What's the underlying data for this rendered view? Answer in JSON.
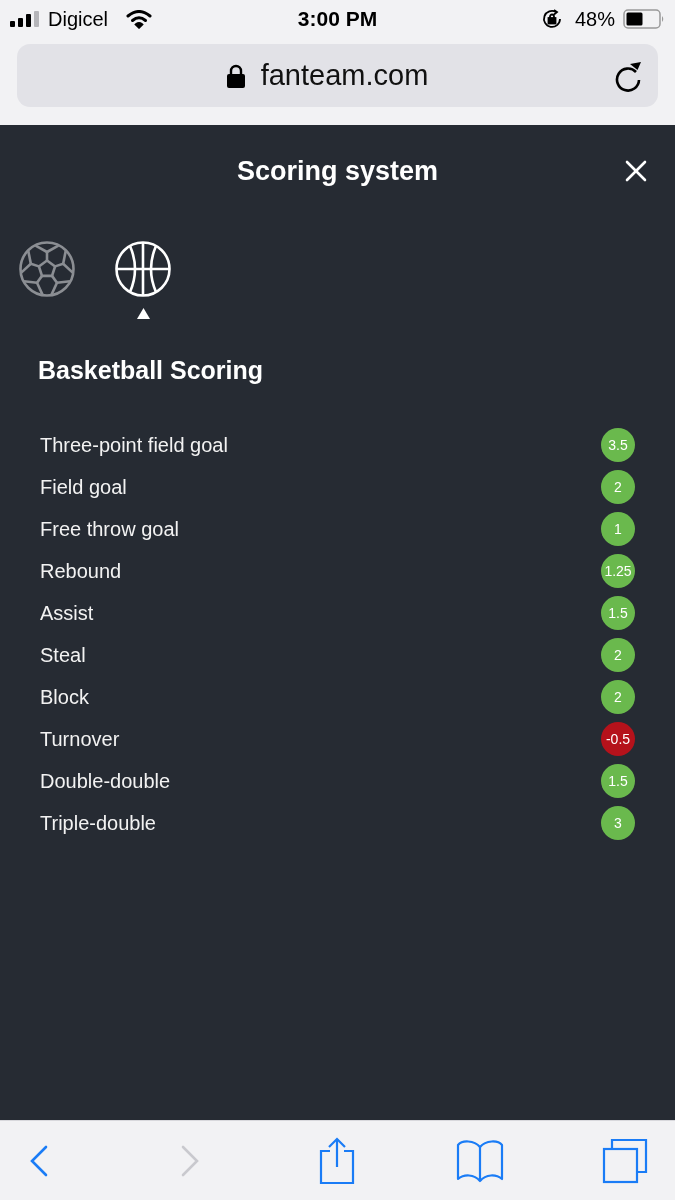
{
  "status_bar": {
    "carrier": "Digicel",
    "time": "3:00 PM",
    "battery": "48%"
  },
  "address_bar": {
    "url": "fanteam.com"
  },
  "modal": {
    "title": "Scoring system",
    "sports": [
      {
        "kind": "soccer",
        "selected": false
      },
      {
        "kind": "basketball",
        "selected": true
      }
    ],
    "heading": "Basketball Scoring",
    "rules": [
      {
        "label": "Three-point field goal",
        "points": "3.5",
        "color": "#6ab94d"
      },
      {
        "label": "Field goal",
        "points": "2",
        "color": "#6ab94d"
      },
      {
        "label": "Free throw goal",
        "points": "1",
        "color": "#6ab94d"
      },
      {
        "label": "Rebound",
        "points": "1.25",
        "color": "#6ab94d"
      },
      {
        "label": "Assist",
        "points": "1.5",
        "color": "#6ab94d"
      },
      {
        "label": "Steal",
        "points": "2",
        "color": "#6ab94d"
      },
      {
        "label": "Block",
        "points": "2",
        "color": "#6ab94d"
      },
      {
        "label": "Turnover",
        "points": "-0.5",
        "color": "#b5121b"
      },
      {
        "label": "Double-double",
        "points": "1.5",
        "color": "#6ab94d"
      },
      {
        "label": "Triple-double",
        "points": "3",
        "color": "#6ab94d"
      }
    ]
  },
  "toolbar": {
    "buttons": [
      {
        "kind": "back",
        "disabled": false
      },
      {
        "kind": "forward",
        "disabled": true
      },
      {
        "kind": "share",
        "disabled": false
      },
      {
        "kind": "bookmarks",
        "disabled": false
      },
      {
        "kind": "tabs",
        "disabled": false
      }
    ]
  }
}
